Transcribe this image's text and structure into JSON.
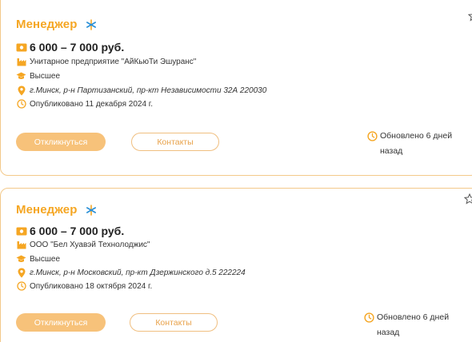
{
  "colors": {
    "accent": "#f5a623",
    "button_fill": "#f7c27a",
    "border": "#f3c98a"
  },
  "vacancies": [
    {
      "title": "Менеджер",
      "salary": "6 000 – 7 000 руб.",
      "company": "Унитарное предприятие \"АйКьюТи Эшуранс\"",
      "education": "Высшее",
      "address": "г.Минск, р-н Партизанский, пр-кт Независимости 32А 220030",
      "published": "Опубликовано 11 декабря 2024 г.",
      "apply_label": "Откликнуться",
      "contacts_label": "Контакты",
      "updated": "Обновлено 6 дней назад",
      "icons": [
        "snowflake-icon",
        "star-icon",
        "money-icon",
        "company-icon",
        "education-icon",
        "location-icon",
        "clock-icon"
      ]
    },
    {
      "title": "Менеджер",
      "salary": "6 000 – 7 000 руб.",
      "company": "ООО \"Бел Хуавэй Технолоджис\"",
      "education": "Высшее",
      "address": "г.Минск, р-н Московский, пр-кт Дзержинского д.5 222224",
      "published": "Опубликовано 18 октября 2024 г.",
      "apply_label": "Откликнуться",
      "contacts_label": "Контакты",
      "updated": "Обновлено 6 дней назад",
      "icons": [
        "snowflake-icon",
        "star-icon",
        "money-icon",
        "company-icon",
        "education-icon",
        "location-icon",
        "clock-icon"
      ]
    }
  ]
}
